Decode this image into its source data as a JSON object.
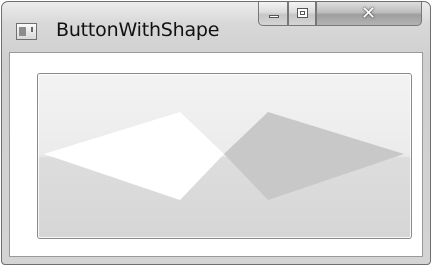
{
  "window": {
    "title": "ButtonWithShape"
  },
  "caption_buttons": {
    "minimize_icon": "minimize-icon",
    "maximize_icon": "maximize-icon",
    "close_icon": "close-icon",
    "close_glyph": "✕"
  },
  "button": {
    "shape_fill": "#ffffff",
    "shape_overlap_fill": "#c8c8c8"
  }
}
